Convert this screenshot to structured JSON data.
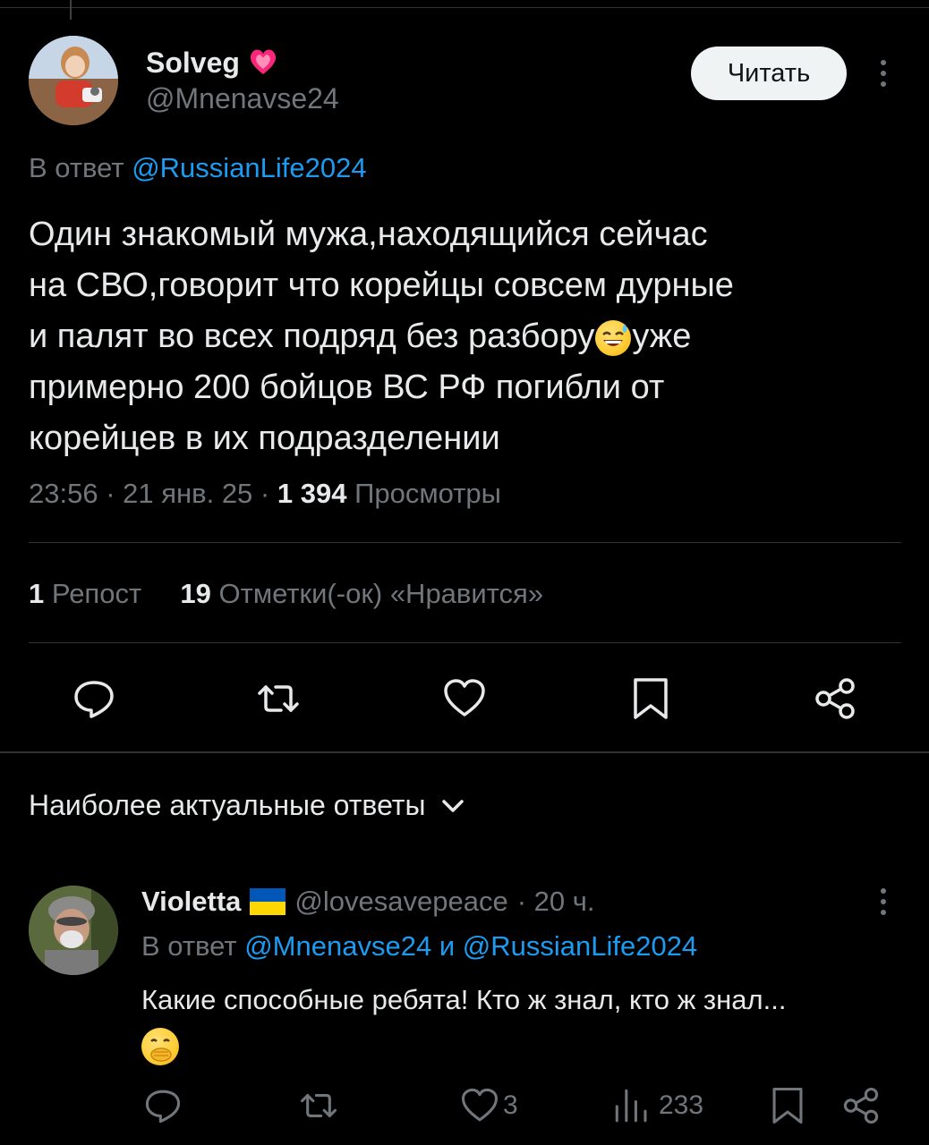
{
  "tweet": {
    "display_name": "Solveg",
    "handle": "@Mnenavse24",
    "follow_label": "Читать",
    "reply_prefix": "В ответ",
    "reply_mention": "@RussianLife2024",
    "text_lines": [
      "Один знакомый мужа,находящийся сейчас",
      "на СВО,говорит что корейцы совсем дурные",
      "и палят во всех подряд без разбору",
      "уже",
      "примерно 200 бойцов ВС РФ погибли от",
      "корейцев в их подразделении"
    ],
    "time": "23:56 · 21 янв. 25 ·",
    "views_count": "1 394",
    "views_label": "Просмотры",
    "reposts_count": "1",
    "reposts_label": "Репост",
    "likes_count": "19",
    "likes_label": "Отметки(-ок) «Нравится»"
  },
  "replies_section": {
    "title": "Наиболее актуальные ответы"
  },
  "reply": {
    "display_name": "Violetta",
    "handle": "@lovesavepeace",
    "time": "· 20 ч.",
    "reply_prefix": "В ответ",
    "mention1": "@Mnenavse24",
    "conjunction": "и",
    "mention2": "@RussianLife2024",
    "text": "Какие способные ребята! Кто ж знал, кто ж знал...",
    "likes": "3",
    "views": "233"
  },
  "colors": {
    "background": "#000000",
    "text": "#e7e9ea",
    "muted": "#71767b",
    "accent": "#1d9bf0",
    "divider": "#2f3336"
  },
  "icons": [
    "more-icon",
    "reply-icon",
    "retweet-icon",
    "like-icon",
    "bookmark-icon",
    "share-icon",
    "chevron-down-icon",
    "views-icon"
  ]
}
